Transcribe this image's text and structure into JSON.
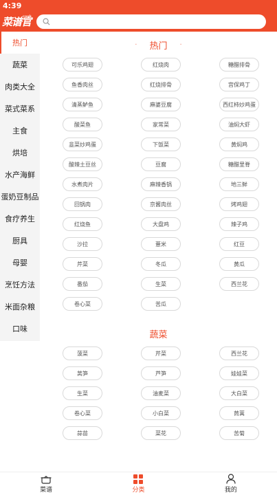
{
  "status": {
    "time": "4:39"
  },
  "header": {
    "logo_text": "菜谱官",
    "logo_small": "cook",
    "search_placeholder": ""
  },
  "sidebar": {
    "items": [
      {
        "label": "热门"
      },
      {
        "label": "蔬菜"
      },
      {
        "label": "肉类大全"
      },
      {
        "label": "菜式菜系"
      },
      {
        "label": "主食"
      },
      {
        "label": "烘培"
      },
      {
        "label": "水产海鲜"
      },
      {
        "label": "蛋奶豆制品"
      },
      {
        "label": "食疗养生"
      },
      {
        "label": "厨具"
      },
      {
        "label": "母婴"
      },
      {
        "label": "烹饪方法"
      },
      {
        "label": "米面杂粮"
      },
      {
        "label": "口味"
      }
    ],
    "active_index": 0
  },
  "sections": [
    {
      "title": "热门",
      "tags": [
        "可乐鸡翅",
        "红烧肉",
        "糖醋排骨",
        "鱼香肉丝",
        "红烧排骨",
        "宫保鸡丁",
        "清蒸鲈鱼",
        "麻婆豆腐",
        "西红柿炒鸡蛋",
        "酸菜鱼",
        "家常菜",
        "油焖大虾",
        "韭菜炒鸡蛋",
        "下饭菜",
        "黄焖鸡",
        "酸辣土豆丝",
        "豆腐",
        "糖醋里脊",
        "水煮肉片",
        "麻辣香锅",
        "地三鲜",
        "回锅肉",
        "京酱肉丝",
        "烤鸡翅",
        "红烧鱼",
        "大盘鸡",
        "辣子鸡",
        "沙拉",
        "薏米",
        "红豆",
        "芹菜",
        "冬瓜",
        "黄瓜",
        "番茄",
        "生菜",
        "西兰花",
        "卷心菜",
        "苦瓜"
      ]
    },
    {
      "title": "蔬菜",
      "tags": [
        "菠菜",
        "芹菜",
        "西兰花",
        "莴笋",
        "芦笋",
        "娃娃菜",
        "生菜",
        "油麦菜",
        "大白菜",
        "卷心菜",
        "小白菜",
        "茼蒿",
        "蒜苗",
        "菜花",
        "苦菊"
      ]
    }
  ],
  "tabbar": [
    {
      "label": "菜谱",
      "icon": "pot-icon"
    },
    {
      "label": "分类",
      "icon": "grid-icon",
      "active": true
    },
    {
      "label": "我的",
      "icon": "user-icon"
    }
  ],
  "colors": {
    "accent": "#ee4c2b"
  }
}
